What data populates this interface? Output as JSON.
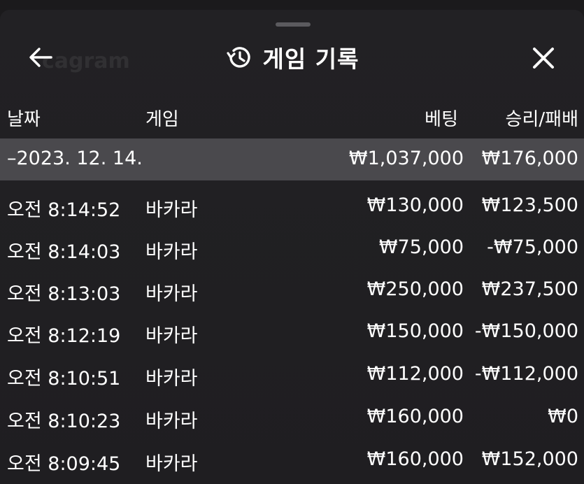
{
  "header": {
    "title": "게임 기록",
    "back_icon": "arrow-left-icon",
    "history_icon": "history-clock-icon",
    "close_icon": "close-icon"
  },
  "columns": {
    "date": "날짜",
    "game": "게임",
    "bet": "베팅",
    "result": "승리/패배"
  },
  "date_group": {
    "date": "–2023. 12. 14.",
    "bet_total": "₩1,037,000",
    "result_total": "₩176,000"
  },
  "rows": [
    {
      "time": "오전 8:14:52",
      "game": "바카라",
      "bet": "₩130,000",
      "result": "₩123,500"
    },
    {
      "time": "오전 8:14:03",
      "game": "바카라",
      "bet": "₩75,000",
      "result": "-₩75,000"
    },
    {
      "time": "오전 8:13:03",
      "game": "바카라",
      "bet": "₩250,000",
      "result": "₩237,500"
    },
    {
      "time": "오전 8:12:19",
      "game": "바카라",
      "bet": "₩150,000",
      "result": "-₩150,000"
    },
    {
      "time": "오전 8:10:51",
      "game": "바카라",
      "bet": "₩112,000",
      "result": "-₩112,000"
    },
    {
      "time": "오전 8:10:23",
      "game": "바카라",
      "bet": "₩160,000",
      "result": "₩0"
    },
    {
      "time": "오전 8:09:45",
      "game": "바카라",
      "bet": "₩160,000",
      "result": "₩152,000"
    }
  ],
  "colors": {
    "background": "#1f1e21",
    "date_row": "#4a494d",
    "text": "#ffffff"
  }
}
